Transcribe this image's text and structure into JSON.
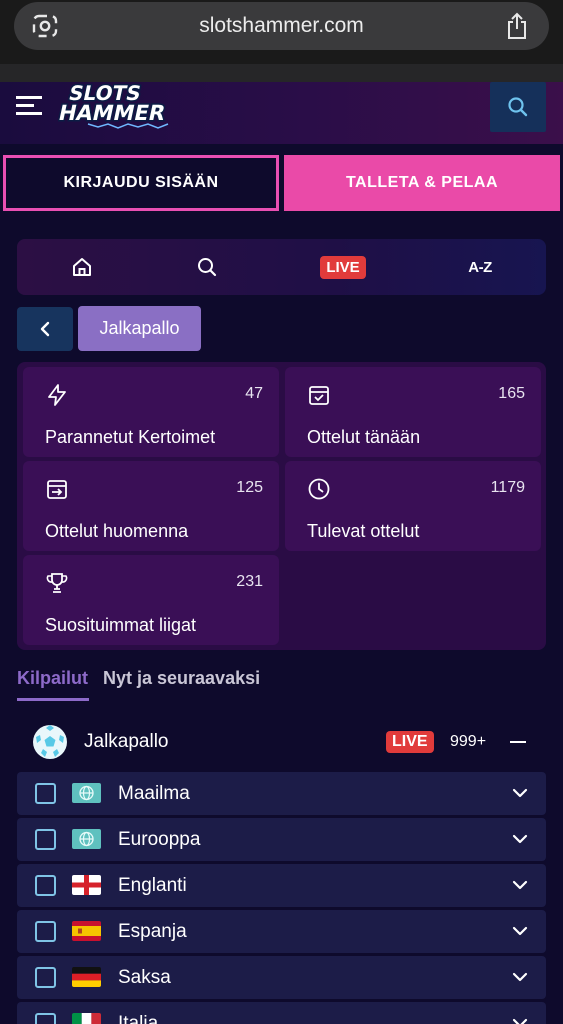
{
  "browser": {
    "url": "slotshammer.com"
  },
  "header": {
    "logo_line1": "SLOTS",
    "logo_line2": "HAMMER"
  },
  "auth": {
    "login_label": "KIRJAUDU SISÄÄN",
    "deposit_label": "TALLETA & PELAA"
  },
  "sport_nav": {
    "live_label": "LIVE",
    "az_label": "A-Z"
  },
  "breadcrumb": {
    "current": "Jalkapallo"
  },
  "categories": [
    {
      "label": "Parannetut Kertoimet",
      "count": "47",
      "icon": "lightning-icon"
    },
    {
      "label": "Ottelut tänään",
      "count": "165",
      "icon": "calendar-check-icon"
    },
    {
      "label": "Ottelut huomenna",
      "count": "125",
      "icon": "calendar-next-icon"
    },
    {
      "label": "Tulevat ottelut",
      "count": "1179",
      "icon": "clock-icon"
    },
    {
      "label": "Suosituimmat liigat",
      "count": "231",
      "icon": "trophy-icon"
    }
  ],
  "tabs": [
    {
      "label": "Kilpailut",
      "active": true
    },
    {
      "label": "Nyt ja seuraavaksi",
      "active": false
    }
  ],
  "sport": {
    "name": "Jalkapallo",
    "live_label": "LIVE",
    "count": "999+"
  },
  "countries": [
    {
      "name": "Maailma",
      "flag": "globe"
    },
    {
      "name": "Eurooppa",
      "flag": "globe"
    },
    {
      "name": "Englanti",
      "flag": "england"
    },
    {
      "name": "Espanja",
      "flag": "spain"
    },
    {
      "name": "Saksa",
      "flag": "germany"
    },
    {
      "name": "Italia",
      "flag": "italy"
    }
  ],
  "colors": {
    "accent_pink": "#ea4aa8",
    "accent_purple": "#8d6ac9",
    "live_red": "#e13b3b",
    "background": "#0e0a2c"
  }
}
